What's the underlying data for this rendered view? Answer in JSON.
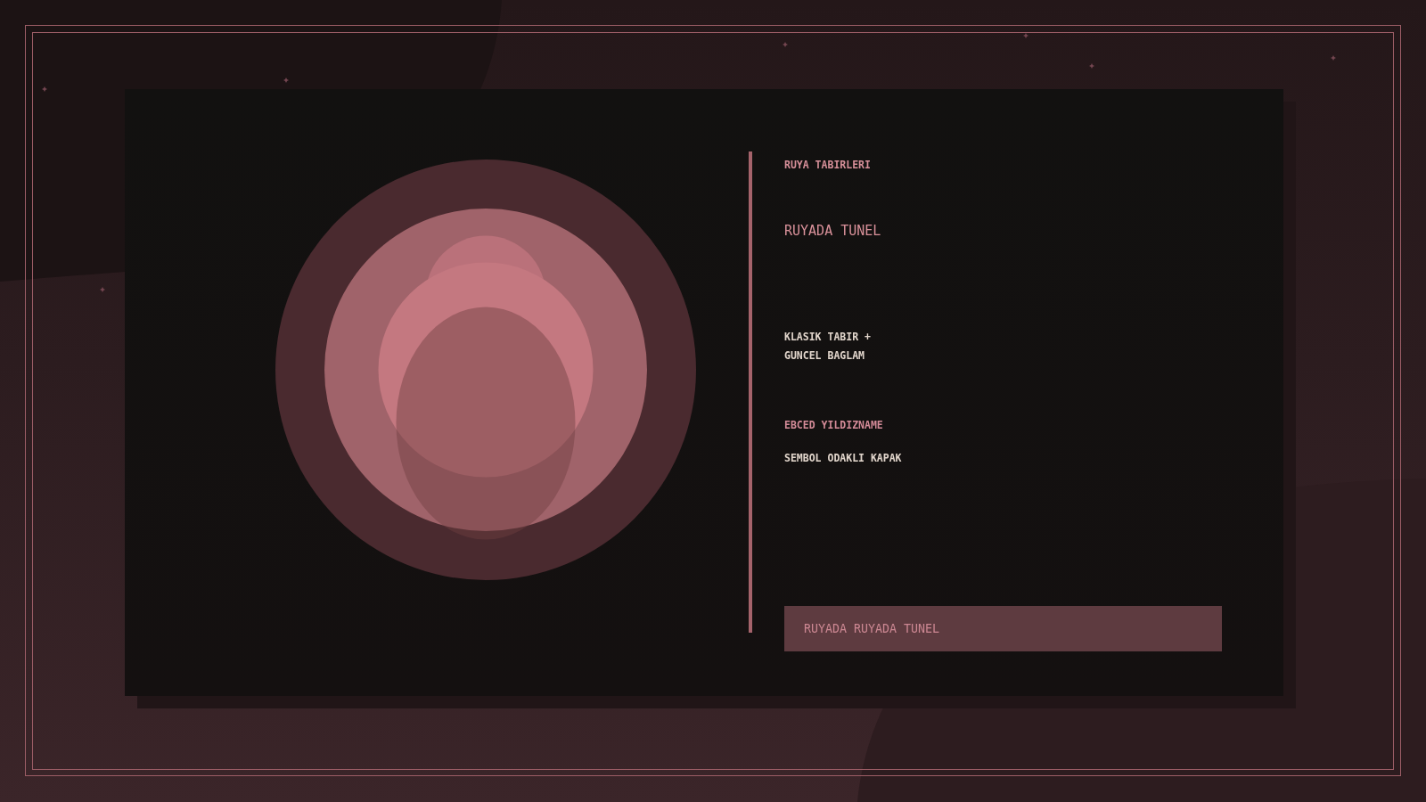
{
  "panel": {
    "eyebrow": "RUYA TABIRLERI",
    "title": "RUYADA TUNEL",
    "description": "KLASIK TABIR + GUNCEL BAGLAM",
    "publisher": "EBCED YILDIZNAME",
    "subtitle": "SEMBOL ODAKLI KAPAK",
    "banner": "RUYADA RUYADA TUNEL"
  }
}
